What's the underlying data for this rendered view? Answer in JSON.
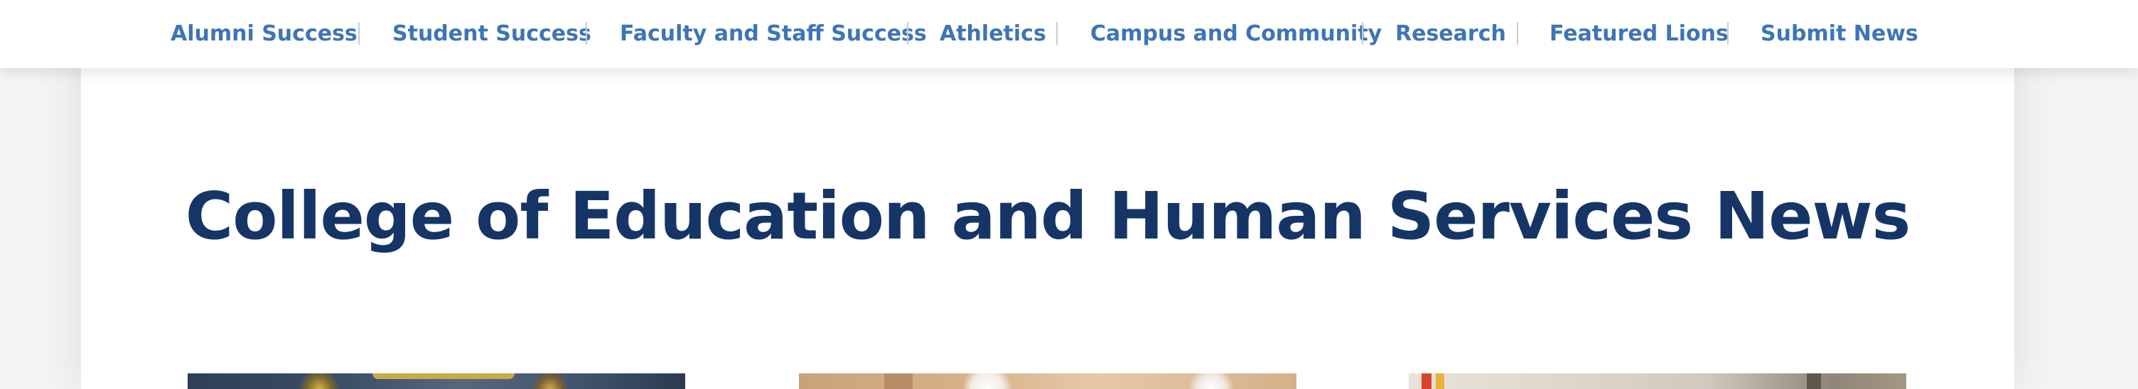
{
  "nav": {
    "items": [
      {
        "label": "Alumni Success"
      },
      {
        "label": "Student Success"
      },
      {
        "label": "Faculty and Staff Success"
      },
      {
        "label": "Athletics"
      },
      {
        "label": "Campus and Community"
      },
      {
        "label": "Research"
      },
      {
        "label": "Featured Lions"
      },
      {
        "label": "Submit News"
      }
    ]
  },
  "main": {
    "title": "College of Education and Human Services News"
  },
  "colors": {
    "nav_link": "#3d75b6",
    "title": "#163567",
    "page_background": "#f4f4f4",
    "card_background": "#ffffff"
  },
  "articles": [
    {
      "image_icon": "news-photo-icon"
    },
    {
      "image_icon": "news-photo-icon"
    },
    {
      "image_icon": "news-photo-icon"
    }
  ]
}
